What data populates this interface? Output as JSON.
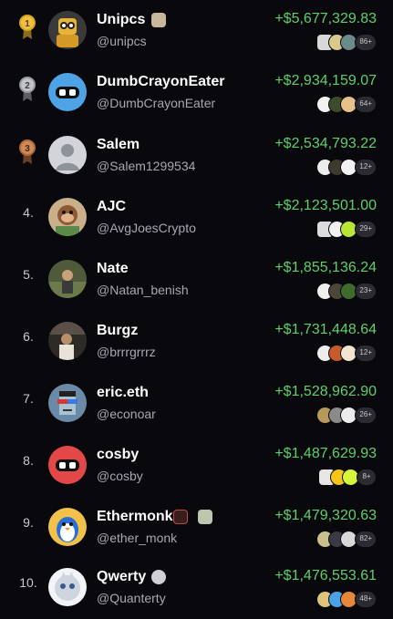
{
  "leaderboard": [
    {
      "rank": "1",
      "name": "Unipcs",
      "handle": "@unipcs",
      "pnl": "+$5,677,329.83",
      "more": "86+",
      "medal": "gold",
      "chips": [
        {
          "color": "#d8d8d8",
          "shape": "sq"
        },
        {
          "color": "#d9c98d",
          "shape": "round"
        },
        {
          "color": "#6b8a8a",
          "shape": "round"
        }
      ]
    },
    {
      "rank": "2",
      "name": "DumbCrayonEater",
      "handle": "@DumbCrayonEater",
      "pnl": "+$2,934,159.07",
      "more": "64+",
      "medal": "silver",
      "chips": [
        {
          "color": "#f2f2f2",
          "shape": "round"
        },
        {
          "color": "#3e4a2c",
          "shape": "round"
        },
        {
          "color": "#e8c08a",
          "shape": "round"
        }
      ]
    },
    {
      "rank": "3",
      "name": "Salem",
      "handle": "@Salem1299534",
      "pnl": "+$2,534,793.22",
      "more": "12+",
      "medal": "bronze",
      "chips": [
        {
          "color": "#ededed",
          "shape": "round"
        },
        {
          "color": "#3d3a30",
          "shape": "round"
        },
        {
          "color": "#f2f2f2",
          "shape": "round"
        }
      ]
    },
    {
      "rank": "4.",
      "name": "AJC",
      "handle": "@AvgJoesCrypto",
      "pnl": "+$2,123,501.00",
      "more": "29+",
      "medal": "",
      "chips": [
        {
          "color": "#dcdcdc",
          "shape": "sq"
        },
        {
          "color": "#f2f2f2",
          "shape": "round"
        },
        {
          "color": "#b8e635",
          "shape": "round"
        }
      ]
    },
    {
      "rank": "5.",
      "name": "Nate",
      "handle": "@Natan_benish",
      "pnl": "+$1,855,136.24",
      "more": "23+",
      "medal": "",
      "chips": [
        {
          "color": "#f0f0f0",
          "shape": "round"
        },
        {
          "color": "#4a463a",
          "shape": "round"
        },
        {
          "color": "#3f6b2c",
          "shape": "round"
        }
      ]
    },
    {
      "rank": "6.",
      "name": "Burgz",
      "handle": "@brrrgrrrz",
      "pnl": "+$1,731,448.64",
      "more": "12+",
      "medal": "",
      "chips": [
        {
          "color": "#ededed",
          "shape": "round"
        },
        {
          "color": "#c75c2a",
          "shape": "round"
        },
        {
          "color": "#f0e6d2",
          "shape": "round"
        }
      ]
    },
    {
      "rank": "7.",
      "name": "eric.eth",
      "handle": "@econoar",
      "pnl": "+$1,528,962.90",
      "more": "26+",
      "medal": "",
      "chips": [
        {
          "color": "#b59a5c",
          "shape": "round"
        },
        {
          "color": "#8a8a8a",
          "shape": "round"
        },
        {
          "color": "#ececec",
          "shape": "round"
        }
      ]
    },
    {
      "rank": "8.",
      "name": "cosby",
      "handle": "@cosby",
      "pnl": "+$1,487,629.93",
      "more": "8+",
      "medal": "",
      "chips": [
        {
          "color": "#e6e6e6",
          "shape": "sq"
        },
        {
          "color": "#f5c518",
          "shape": "round"
        },
        {
          "color": "#d4f53a",
          "shape": "round"
        }
      ]
    },
    {
      "rank": "9.",
      "name": "Ethermonk",
      "handle": "@ether_monk",
      "pnl": "+$1,479,320.63",
      "more": "82+",
      "medal": "",
      "chips": [
        {
          "color": "#cbbf8e",
          "shape": "round"
        },
        {
          "color": "#3a3a44",
          "shape": "round"
        },
        {
          "color": "#d8d8d8",
          "shape": "round"
        }
      ]
    },
    {
      "rank": "10.",
      "name": "Qwerty",
      "handle": "@Quanterty",
      "pnl": "+$1,476,553.61",
      "more": "48+",
      "medal": "",
      "chips": [
        {
          "color": "#e0c27a",
          "shape": "round"
        },
        {
          "color": "#4aa3e8",
          "shape": "round"
        },
        {
          "color": "#e8873a",
          "shape": "round"
        }
      ]
    }
  ],
  "colors": {
    "background": "#09090d",
    "pnl_green": "#5fcf6b",
    "handle_gray": "#a7a7b3"
  }
}
